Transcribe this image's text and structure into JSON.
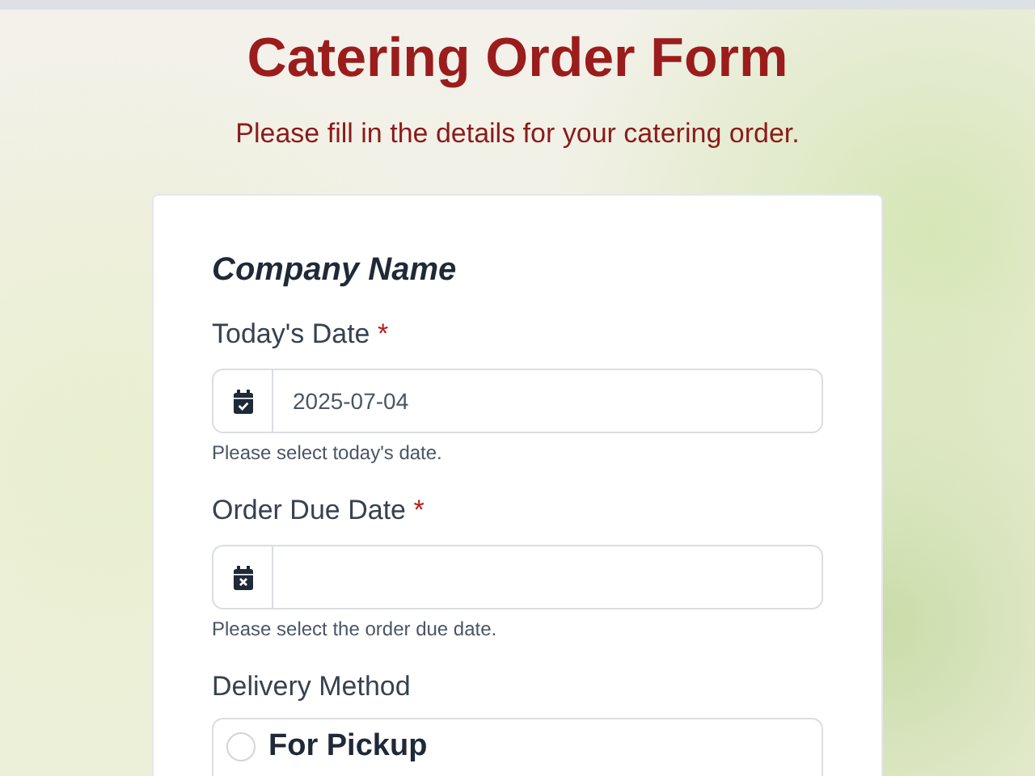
{
  "header": {
    "title": "Catering Order Form",
    "subtitle": "Please fill in the details for your catering order."
  },
  "form": {
    "heading": "Company Name",
    "fields": [
      {
        "kind": "date",
        "label": "Today's Date",
        "required": true,
        "required_mark": "*",
        "value": "2025-07-04",
        "hint": "Please select today's date."
      },
      {
        "kind": "date",
        "label": "Order Due Date",
        "required": true,
        "required_mark": "*",
        "hint": "Please select the order due date."
      },
      {
        "kind": "radio",
        "label": "Delivery Method",
        "options": [
          {
            "label": "For Pickup",
            "selected": false
          }
        ]
      }
    ]
  }
}
